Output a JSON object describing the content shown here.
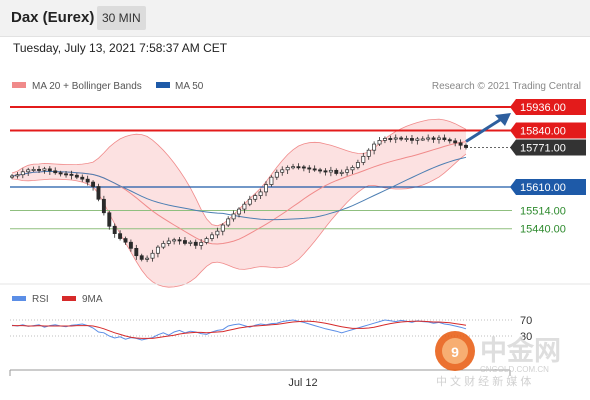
{
  "header": {
    "title": "Dax (Eurex)",
    "timeframe": "30 MIN"
  },
  "timestamp": "Tuesday, July 13, 2021 7:58:37 AM CET",
  "legend": {
    "bollinger": "MA 20 + Bollinger Bands",
    "ma50": "MA 50",
    "rsi": "RSI",
    "rsi_ma": "9MA"
  },
  "credit": "Research © 2021 Trading Central",
  "watermark": {
    "brand": "中金网",
    "domain": "CNGOLD.COM.CN",
    "tagline": "中 文 财 经 新 媒 体"
  },
  "colors": {
    "resistance": "#e31b1b",
    "support": "#1e5aa8",
    "minor_support": "#8fbf7f",
    "bollinger": "#f08a8a",
    "ma50": "#4d7fb3",
    "rsi": "#5b8ee6",
    "rsi_ma": "#d62a2a",
    "arrow": "#2e5f9e",
    "candle_up": "#2a2a2a",
    "candle_down": "#2a2a2a"
  },
  "chart_data": {
    "type": "candlestick",
    "x_label": "Jul 12",
    "price_levels": [
      {
        "value": 15936.0,
        "label": "15936.00",
        "kind": "resistance"
      },
      {
        "value": 15840.0,
        "label": "15840.00",
        "kind": "resistance"
      },
      {
        "value": 15771.0,
        "label": "15771.00",
        "kind": "last"
      },
      {
        "value": 15610.0,
        "label": "15610.00",
        "kind": "pivot"
      },
      {
        "value": 15514.0,
        "label": "15514.00",
        "kind": "support"
      },
      {
        "value": 15440.0,
        "label": "15440.00",
        "kind": "support"
      }
    ],
    "close": [
      15655,
      15660,
      15672,
      15680,
      15682,
      15678,
      15684,
      15676,
      15668,
      15664,
      15662,
      15658,
      15650,
      15642,
      15630,
      15612,
      15560,
      15505,
      15450,
      15420,
      15400,
      15385,
      15360,
      15330,
      15315,
      15320,
      15340,
      15365,
      15380,
      15390,
      15395,
      15392,
      15380,
      15385,
      15372,
      15384,
      15400,
      15415,
      15430,
      15455,
      15480,
      15500,
      15520,
      15540,
      15560,
      15575,
      15590,
      15620,
      15650,
      15670,
      15680,
      15690,
      15693,
      15692,
      15688,
      15684,
      15680,
      15676,
      15671,
      15678,
      15665,
      15670,
      15680,
      15690,
      15710,
      15735,
      15760,
      15785,
      15800,
      15808,
      15806,
      15810,
      15805,
      15808,
      15800,
      15806,
      15806,
      15810,
      15804,
      15810,
      15803,
      15798,
      15790,
      15780,
      15771
    ],
    "rsi": {
      "levels": [
        70,
        30
      ],
      "rsi": [
        57,
        55,
        58,
        54,
        56,
        58,
        52,
        56,
        58,
        55,
        53,
        57,
        58,
        60,
        56,
        50,
        40,
        38,
        30,
        25,
        28,
        22,
        26,
        24,
        20,
        23,
        26,
        33,
        38,
        32,
        40,
        44,
        38,
        42,
        40,
        36,
        34,
        40,
        44,
        46,
        55,
        58,
        60,
        56,
        52,
        57,
        60,
        58,
        61,
        62,
        66,
        68,
        70,
        67,
        64,
        60,
        56,
        52,
        48,
        45,
        42,
        38,
        42,
        46,
        50,
        54,
        58,
        62,
        66,
        70,
        68,
        66,
        69,
        67,
        64,
        68,
        66,
        65,
        62,
        64,
        60,
        58,
        55,
        52,
        48
      ],
      "ma": [
        56,
        56,
        56,
        55,
        55,
        56,
        55,
        55,
        55,
        55,
        55,
        55,
        56,
        56,
        56,
        55,
        52,
        48,
        43,
        38,
        34,
        30,
        27,
        25,
        24,
        24,
        24,
        26,
        28,
        30,
        32,
        35,
        37,
        38,
        39,
        39,
        38,
        39,
        40,
        41,
        44,
        47,
        50,
        52,
        54,
        55,
        56,
        57,
        58,
        59,
        61,
        63,
        65,
        66,
        67,
        67,
        66,
        64,
        62,
        59,
        56,
        53,
        51,
        49,
        49,
        49,
        50,
        52,
        55,
        58,
        61,
        63,
        65,
        66,
        67,
        67,
        67,
        66,
        65,
        65,
        64,
        63,
        61,
        59,
        57
      ]
    }
  }
}
